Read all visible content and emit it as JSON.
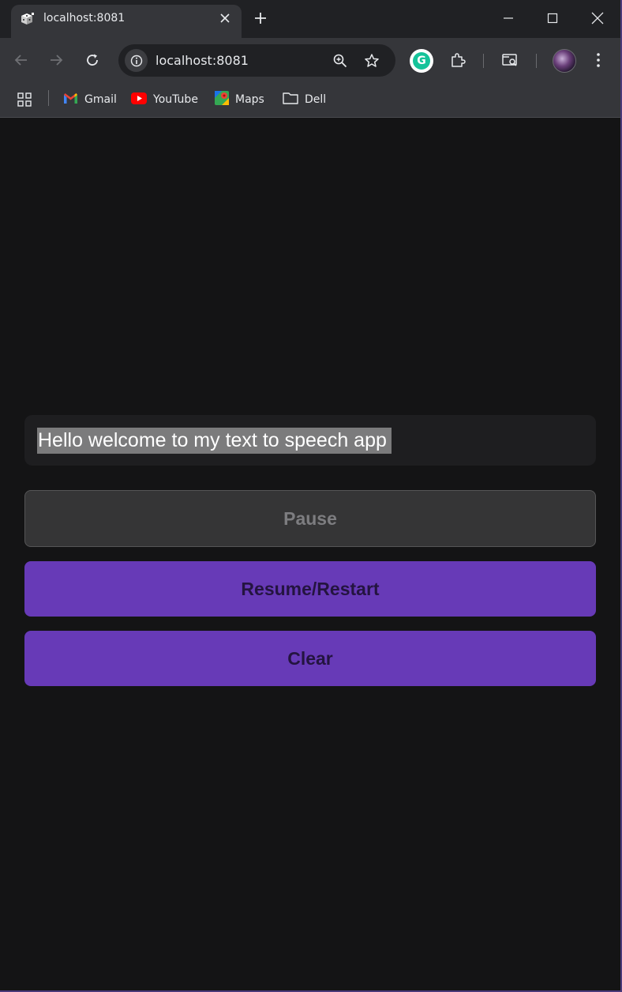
{
  "browser": {
    "tab": {
      "title": "localhost:8081",
      "favicon": "dice-favicon-icon"
    },
    "url": "localhost:8081",
    "bookmarks": [
      {
        "label": "Gmail",
        "icon": "gmail-icon"
      },
      {
        "label": "YouTube",
        "icon": "youtube-icon"
      },
      {
        "label": "Maps",
        "icon": "maps-icon"
      },
      {
        "label": "Dell",
        "icon": "folder-icon"
      }
    ]
  },
  "app": {
    "text_input": {
      "value": "Hello welcome to my text to speech app"
    },
    "buttons": {
      "pause": "Pause",
      "resume": "Resume/Restart",
      "clear": "Clear"
    }
  },
  "colors": {
    "accent": "#673ab7",
    "background": "#141415",
    "disabled_button": "#353536"
  }
}
